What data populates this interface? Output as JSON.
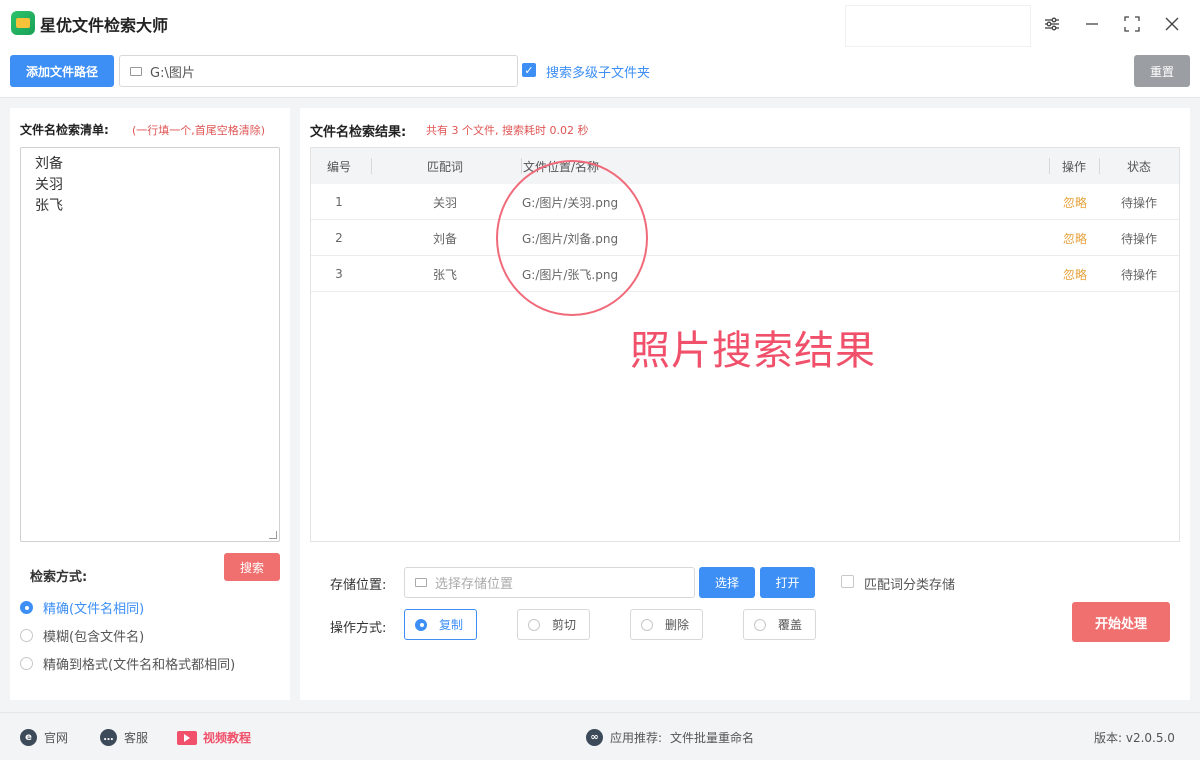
{
  "app": {
    "title": "星优文件检索大师"
  },
  "window_controls": {
    "settings_glyph": "⚙",
    "minimize_glyph": "—",
    "maximize_glyph": "⛶",
    "close_glyph": "✕"
  },
  "toolbar": {
    "add_path_label": "添加文件路径",
    "path_value": "G:\\图片",
    "search_subfolders_checked": true,
    "search_subfolders_label": "搜索多级子文件夹",
    "reset_label": "重置"
  },
  "search_list": {
    "title": "文件名检索清单:",
    "hint": "(一行填一个,首尾空格清除)",
    "names": [
      "刘备",
      "关羽",
      "张飞"
    ],
    "search_mode_label": "检索方式:",
    "search_button_label": "搜索",
    "modes": [
      {
        "label": "精确(文件名相同)",
        "selected": true
      },
      {
        "label": "模糊(包含文件名)",
        "selected": false
      },
      {
        "label": "精确到格式(文件名和格式都相同)",
        "selected": false
      }
    ]
  },
  "results": {
    "title": "文件名检索结果:",
    "summary": "共有 3 个文件, 搜索耗时 0.02 秒",
    "columns": {
      "index": "编号",
      "match": "匹配词",
      "path": "文件位置/名称",
      "action": "操作",
      "status": "状态"
    },
    "rows": [
      {
        "index": "1",
        "match": "关羽",
        "path": "G:/图片/关羽.png",
        "action": "忽略",
        "status": "待操作"
      },
      {
        "index": "2",
        "match": "刘备",
        "path": "G:/图片/刘备.png",
        "action": "忽略",
        "status": "待操作"
      },
      {
        "index": "3",
        "match": "张飞",
        "path": "G:/图片/张飞.png",
        "action": "忽略",
        "status": "待操作"
      }
    ],
    "annotation": "照片搜索结果"
  },
  "storage": {
    "label": "存储位置:",
    "placeholder": "选择存储位置",
    "choose_label": "选择",
    "open_label": "打开",
    "classify_checked": false,
    "classify_label": "匹配词分类存储"
  },
  "operation": {
    "label": "操作方式:",
    "options": [
      {
        "label": "复制",
        "selected": true
      },
      {
        "label": "剪切",
        "selected": false
      },
      {
        "label": "删除",
        "selected": false
      },
      {
        "label": "覆盖",
        "selected": false
      }
    ],
    "start_label": "开始处理"
  },
  "footer": {
    "website": "官网",
    "support": "客服",
    "video": "视频教程",
    "recommend_label": "应用推荐:",
    "recommend_app": "文件批量重命名",
    "version": "版本: v2.0.5.0"
  },
  "colors": {
    "accent": "#3d8ff5",
    "danger": "#f07070",
    "warning": "#e6a23c",
    "annotation": "#f0506a"
  }
}
